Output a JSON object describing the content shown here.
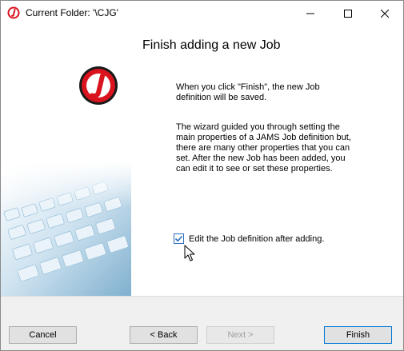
{
  "window": {
    "title": "Current Folder: '\\CJG'",
    "icon": "jams-logo-icon",
    "controls": [
      "minimize-icon",
      "maximize-icon",
      "close-icon"
    ]
  },
  "wizard": {
    "heading": "Finish adding a new Job",
    "paragraph1": "When you click \"Finish\", the new Job definition will be saved.",
    "paragraph2": "The wizard guided you through setting the main properties of a JAMS Job definition but, there are many other properties that you can set.  After the new Job has been added, you can edit it to see or set these properties.",
    "edit_checkbox": {
      "label": "Edit the Job definition after adding.",
      "checked": true
    }
  },
  "buttons": {
    "cancel": "Cancel",
    "back": "< Back",
    "next": "Next >",
    "finish": "Finish"
  },
  "colors": {
    "logo_red": "#d9141e",
    "checkbox_blue": "#2a6cc0",
    "focus_border": "#0078d7"
  }
}
